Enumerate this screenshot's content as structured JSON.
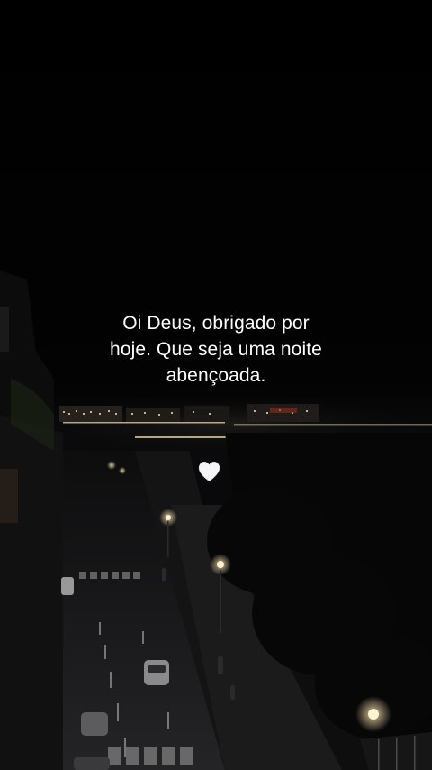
{
  "caption": {
    "lines": [
      "Oi Deus, obrigado por",
      "hoje. Que seja uma noite",
      "abençoada."
    ]
  },
  "emoji": {
    "icon": "white-heart-icon",
    "color": "#f5f5f5"
  },
  "scene": {
    "description_icon": "night-city-street-photo",
    "sky_color": "#000000"
  }
}
